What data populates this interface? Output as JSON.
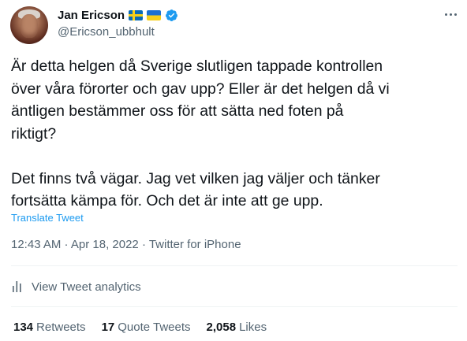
{
  "author": {
    "display_name": "Jan Ericson",
    "handle": "@Ericson_ubbhult"
  },
  "badges": [
    "sweden-flag-icon",
    "ukraine-flag-icon",
    "verified-icon"
  ],
  "colors": {
    "link": "#1d9bf0",
    "secondary_text": "#536471",
    "primary_text": "#0f1419",
    "verified": "#1d9bf0"
  },
  "tweet": {
    "text": "Är detta helgen då Sverige slutligen tappade kontrollen\növer våra förorter och gav upp? Eller är det helgen då vi\näntligen bestämmer oss för att sätta ned foten på\nriktigt?\n\nDet finns två vägar. Jag vet vilken jag väljer och tänker\nfortsätta kämpa för. Och det är inte att ge upp.",
    "translate_label": "Translate Tweet",
    "timestamp": "12:43 AM · Apr 18, 2022 · Twitter for iPhone"
  },
  "analytics": {
    "label": "View Tweet analytics"
  },
  "stats": {
    "retweets_count": "134",
    "retweets_label": "Retweets",
    "quotes_count": "17",
    "quotes_label": "Quote Tweets",
    "likes_count": "2,058",
    "likes_label": "Likes"
  }
}
